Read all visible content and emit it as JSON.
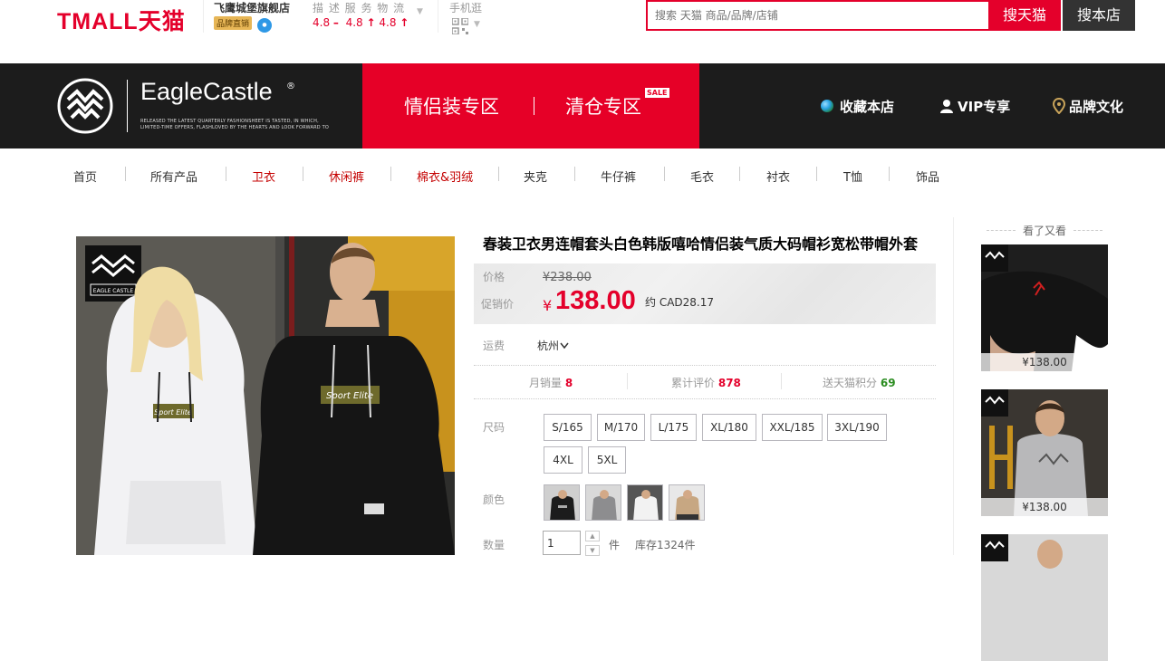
{
  "topbar": {
    "logo": "TMALL天猫",
    "shop_name": "飞鹰城堡旗舰店",
    "shop_badge": "品牌直销",
    "rating_labels": "描 述  服 务  物 流",
    "ratings": [
      "4.8",
      "4.8",
      "4.8"
    ],
    "mobile_label": "手机逛",
    "search_placeholder": "搜索 天猫 商品/品牌/店铺",
    "search_tmall_button": "搜天猫",
    "search_shop_button": "搜本店"
  },
  "banner": {
    "brand": "EagleCastle",
    "reg": "®",
    "tagline": "RELEASED THE LATEST QUARTERLY FASHIONSHEET IS TASTED, IN WHICH, LIMITED-TIME OFFERS, FLASHLOVED BY THE HEARTS AND LOOK FORWARD TO",
    "zone_couple": "情侣装专区",
    "zone_clearance": "清仓专区",
    "sale_badge": "SALE",
    "favorite": "收藏本店",
    "vip": "VIP专享",
    "brand_culture": "品牌文化"
  },
  "nav": {
    "items": [
      "首页",
      "所有产品",
      "卫衣",
      "休闲裤",
      "棉衣&羽绒",
      "夹克",
      "牛仔裤",
      "毛衣",
      "衬衣",
      "T恤",
      "饰品"
    ]
  },
  "product": {
    "title": "春装卫衣男连帽套头白色韩版嘻哈情侣装气质大码帽衫宽松带帽外套",
    "price_label": "价格",
    "original_price": "¥238.00",
    "promo_label": "促销价",
    "currency": "¥",
    "promo_price": "138.00",
    "approx": "约 CAD28.17",
    "shipping_label": "运费",
    "shipping_from": "杭州",
    "stats": [
      {
        "label": "月销量",
        "value": "8"
      },
      {
        "label": "累计评价",
        "value": "878"
      },
      {
        "label": "送天猫积分",
        "value": "69"
      }
    ],
    "size_label": "尺码",
    "sizes": [
      "S/165",
      "M/170",
      "L/175",
      "XL/180",
      "XXL/185",
      "3XL/190",
      "4XL",
      "5XL"
    ],
    "color_label": "颜色",
    "qty_label": "数量",
    "qty_value": "1",
    "unit": "件",
    "stock": "库存1324件",
    "logo_text": "EAGLE CASTLE",
    "hoodie_print": "Sport Elite"
  },
  "also_viewed": {
    "title": "看了又看",
    "items": [
      {
        "price": "¥138.00"
      },
      {
        "price": "¥138.00"
      }
    ]
  },
  "colors": {
    "tmall_red": "#e4002b",
    "banner_dark": "#1c1c1c",
    "banner_red": "#e60027",
    "stat_green": "#2a8c20"
  }
}
